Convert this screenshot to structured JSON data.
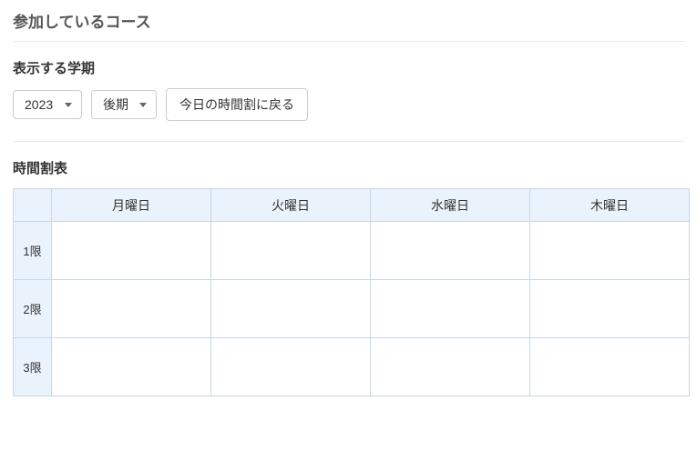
{
  "page": {
    "heading": "参加しているコース"
  },
  "semester": {
    "label": "表示する学期",
    "year_selected": "2023",
    "year_options": [
      "2023"
    ],
    "term_selected": "後期",
    "term_options": [
      "後期"
    ],
    "back_to_today_label": "今日の時間割に戻る"
  },
  "timetable": {
    "title": "時間割表",
    "corner": "",
    "days": [
      "月曜日",
      "火曜日",
      "水曜日",
      "木曜日"
    ],
    "periods": [
      "1限",
      "2限",
      "3限"
    ],
    "cells": [
      [
        "",
        "",
        "",
        ""
      ],
      [
        "",
        "",
        "",
        ""
      ],
      [
        "",
        "",
        "",
        ""
      ]
    ]
  }
}
